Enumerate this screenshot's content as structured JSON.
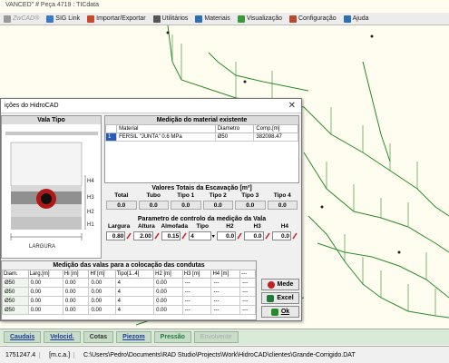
{
  "window": {
    "title": "VANCED\" # Peça 4719 :  TICdata"
  },
  "menu": [
    {
      "label": "ZwCAD®",
      "icon": "zwcad-logo-icon",
      "color": "#999999"
    },
    {
      "label": "SIG Link",
      "icon": "sig-link-icon",
      "color": "#3a7ac8"
    },
    {
      "label": "Importar/Exportar",
      "icon": "import-export-icon",
      "color": "#c84a2a"
    },
    {
      "label": "Utilitários",
      "icon": "tools-icon",
      "color": "#555555"
    },
    {
      "label": "Materiais",
      "icon": "materials-icon",
      "color": "#2a70b8"
    },
    {
      "label": "Visualização",
      "icon": "visualization-icon",
      "color": "#3a9a3a"
    },
    {
      "label": "Configuração",
      "icon": "settings-icon",
      "color": "#b84a2a"
    },
    {
      "label": "Ajuda",
      "icon": "help-icon",
      "color": "#2a70b8"
    }
  ],
  "dialog": {
    "title": "ições do HidroCAD",
    "vala_tipo": {
      "heading": "Vala Tipo",
      "labels": [
        "H4",
        "H3",
        "H2",
        "H1"
      ],
      "width_label": "LARGURA"
    },
    "measure": {
      "heading": "Medição do material existente",
      "columns": [
        "",
        "Material",
        "Diametro",
        "Comp.[m]"
      ],
      "rows": [
        {
          "n": "1",
          "material": "FERSIL \"JUNTA\"  0.6 MPa",
          "diam": "Ø50",
          "comp": "382098.47"
        }
      ]
    },
    "totais": {
      "heading": "Valores Totais da Escavação  [m³]",
      "columns": [
        "Total",
        "Tubo",
        "Tipo 1",
        "Tipo 2",
        "Tipo 3",
        "Tipo 4"
      ],
      "values": [
        "0.0",
        "0.0",
        "0.0",
        "0.0",
        "0.0",
        "0.0"
      ]
    },
    "params": {
      "heading": "Parametro de controlo da medição da Vala",
      "columns": [
        "Largura",
        "Altura",
        "Almofada",
        "Tipo",
        "H2",
        "H3",
        "H4"
      ],
      "values": [
        "0.80",
        "2.00",
        "0.15",
        "4",
        "0.0",
        "0.0",
        "0.0"
      ]
    },
    "condutas": {
      "heading": "Medição das valas para a colocação das condutas",
      "columns": [
        "Diam.",
        "Larg.[m]",
        "Hi [m]",
        "Hf [m]",
        "Tipo[1..4]",
        "H2 [m]",
        "H3 [m]",
        "H4 [m]",
        "---"
      ],
      "rows": [
        [
          "Ø50",
          "0.00",
          "0.00",
          "0.00",
          "4",
          "0.00",
          "---",
          "---",
          "---"
        ],
        [
          "Ø50",
          "0.00",
          "0.00",
          "0.00",
          "4",
          "0.00",
          "---",
          "---",
          "---"
        ],
        [
          "Ø50",
          "0.00",
          "0.00",
          "0.00",
          "4",
          "0.00",
          "---",
          "---",
          "---"
        ],
        [
          "Ø50",
          "0.00",
          "0.00",
          "0.00",
          "4",
          "0.00",
          "---",
          "---",
          "---"
        ]
      ]
    },
    "buttons": {
      "mede": "Mede",
      "excel": "Excel",
      "ok": "Ok"
    }
  },
  "tabs": [
    {
      "label": "Caudais",
      "style": "link"
    },
    {
      "label": "Velocid.",
      "style": "link"
    },
    {
      "label": "Cotas",
      "style": "plain"
    },
    {
      "label": "Piezom",
      "style": "link"
    },
    {
      "label": "Pressão",
      "style": "green"
    },
    {
      "label": "Envolvente",
      "style": "disabled"
    }
  ],
  "status": {
    "coord": "1751247.4",
    "unit": "[m.c.a.]",
    "path": "C:\\Users\\Pedro\\Documents\\RAD Studio\\Projects\\Work\\HidroCAD\\clientes\\Grande-Corrigido.DAT"
  }
}
